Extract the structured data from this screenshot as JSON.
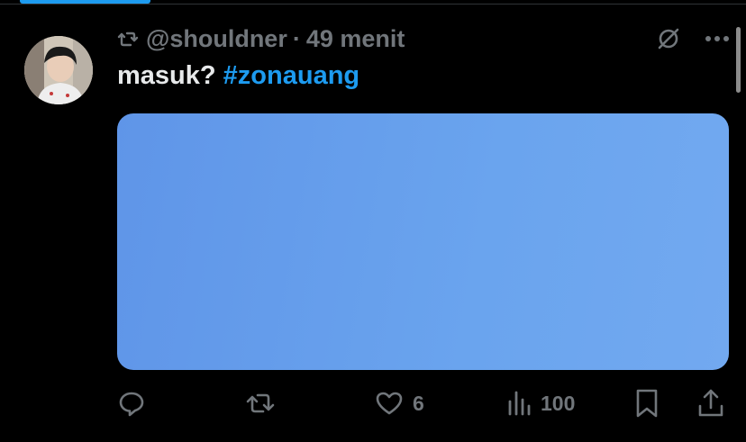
{
  "post": {
    "handle": "@shouldner",
    "separator": "·",
    "time_ago": "49 menit",
    "text_main": "masuk? ",
    "hashtag": "#zonauang",
    "media_color": "#6aa4ee"
  },
  "actions": {
    "reply_count": "",
    "repost_count": "",
    "like_count": "6",
    "views_count": "100"
  },
  "icons": {
    "repost_header": "repost-icon",
    "grok": "grok-icon",
    "more": "more-icon",
    "reply": "reply-icon",
    "repost": "repost-icon",
    "like": "heart-icon",
    "views": "views-icon",
    "bookmark": "bookmark-icon",
    "share": "share-icon"
  },
  "colors": {
    "background": "#000000",
    "secondary_text": "#71767b",
    "primary_text": "#e7e9ea",
    "accent": "#1d9bf0"
  }
}
